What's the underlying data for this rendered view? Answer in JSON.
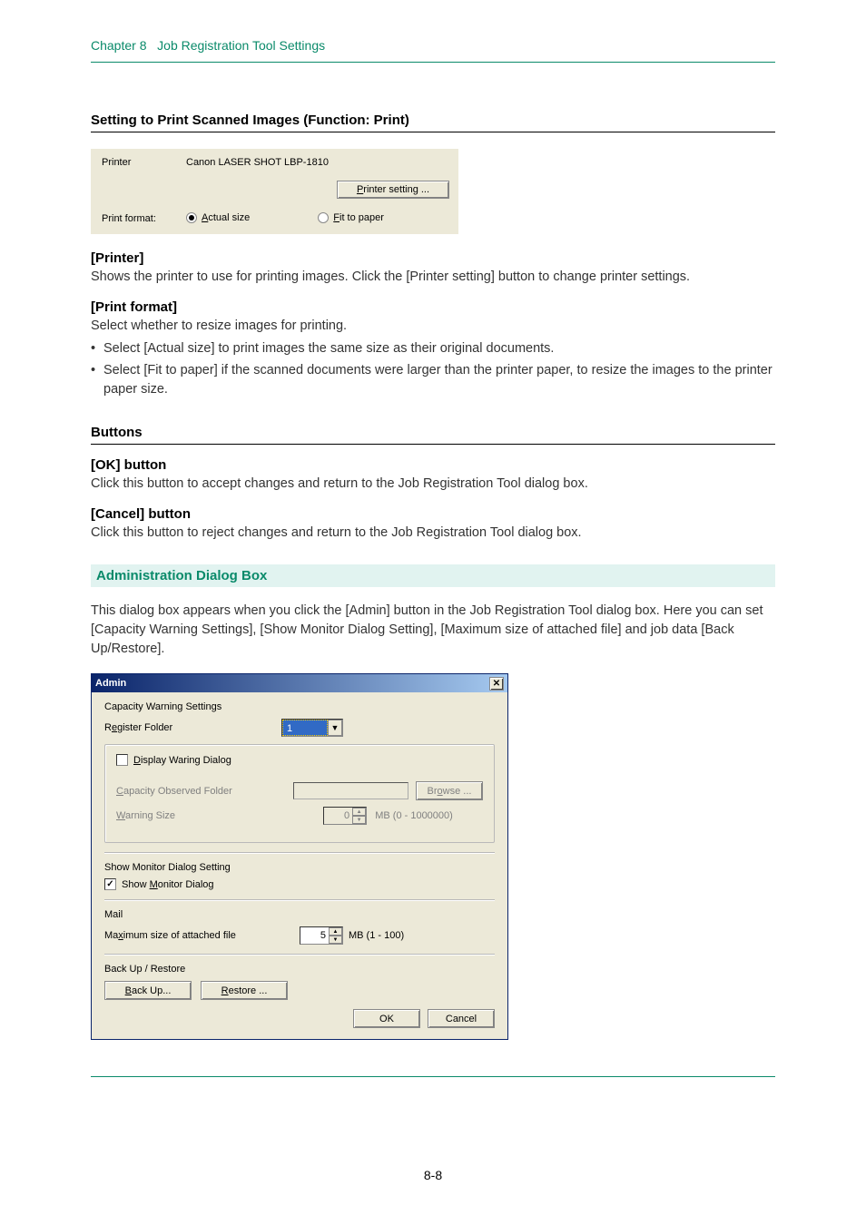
{
  "chapter": {
    "label": "Chapter 8",
    "title": "Job Registration Tool Settings"
  },
  "section1": {
    "title": "Setting to Print Scanned Images (Function: Print)"
  },
  "printer_panel": {
    "printer_label": "Printer",
    "printer_value": "Canon LASER SHOT LBP-1810",
    "printer_setting_btn": "Printer setting ...",
    "print_format_label": "Print format:",
    "actual_size_label": "Actual size",
    "fit_to_paper_label": "Fit to paper"
  },
  "printer_section": {
    "head": "[Printer]",
    "body": "Shows the printer to use for printing images. Click the [Printer setting] button to change printer settings."
  },
  "print_format_section": {
    "head": "[Print format]",
    "intro": "Select whether to resize images for printing.",
    "bullets": [
      "Select [Actual size] to print images the same size as their original documents.",
      "Select [Fit to paper] if the scanned documents were larger than the printer paper, to resize the images to the printer paper size."
    ]
  },
  "buttons_section": {
    "title": "Buttons",
    "ok_head": "[OK] button",
    "ok_body": "Click this button to accept changes and return to the Job Registration Tool dialog box.",
    "cancel_head": "[Cancel] button",
    "cancel_body": "Click this button to reject changes and return to the Job Registration Tool dialog box."
  },
  "admin_section": {
    "title": "Administration Dialog Box",
    "intro": "This dialog box appears when you click the [Admin] button in the Job Registration Tool dialog box. Here you can set [Capacity Warning Settings], [Show Monitor Dialog Setting], [Maximum size of attached file] and job data [Back Up/Restore]."
  },
  "admin_dialog": {
    "title": "Admin",
    "capacity_settings_label": "Capacity Warning Settings",
    "register_folder_label": "Register Folder",
    "register_folder_value": "1",
    "display_warning_label": "Display Waring Dialog",
    "capacity_observed_label": "Capacity Observed Folder",
    "browse_btn": "Browse ...",
    "warning_size_label": "Warning Size",
    "warning_size_value": "0",
    "warning_size_range": "MB (0 - 1000000)",
    "show_monitor_setting_label": "Show Monitor Dialog Setting",
    "show_monitor_label": "Show Monitor Dialog",
    "mail_label": "Mail",
    "max_attach_label": "Maximum size of attached file",
    "max_attach_value": "5",
    "max_attach_range": "MB (1 - 100)",
    "backup_restore_label": "Back Up / Restore",
    "backup_btn": "Back Up...",
    "restore_btn": "Restore ...",
    "ok_btn": "OK",
    "cancel_btn": "Cancel"
  },
  "page_number": "8-8"
}
